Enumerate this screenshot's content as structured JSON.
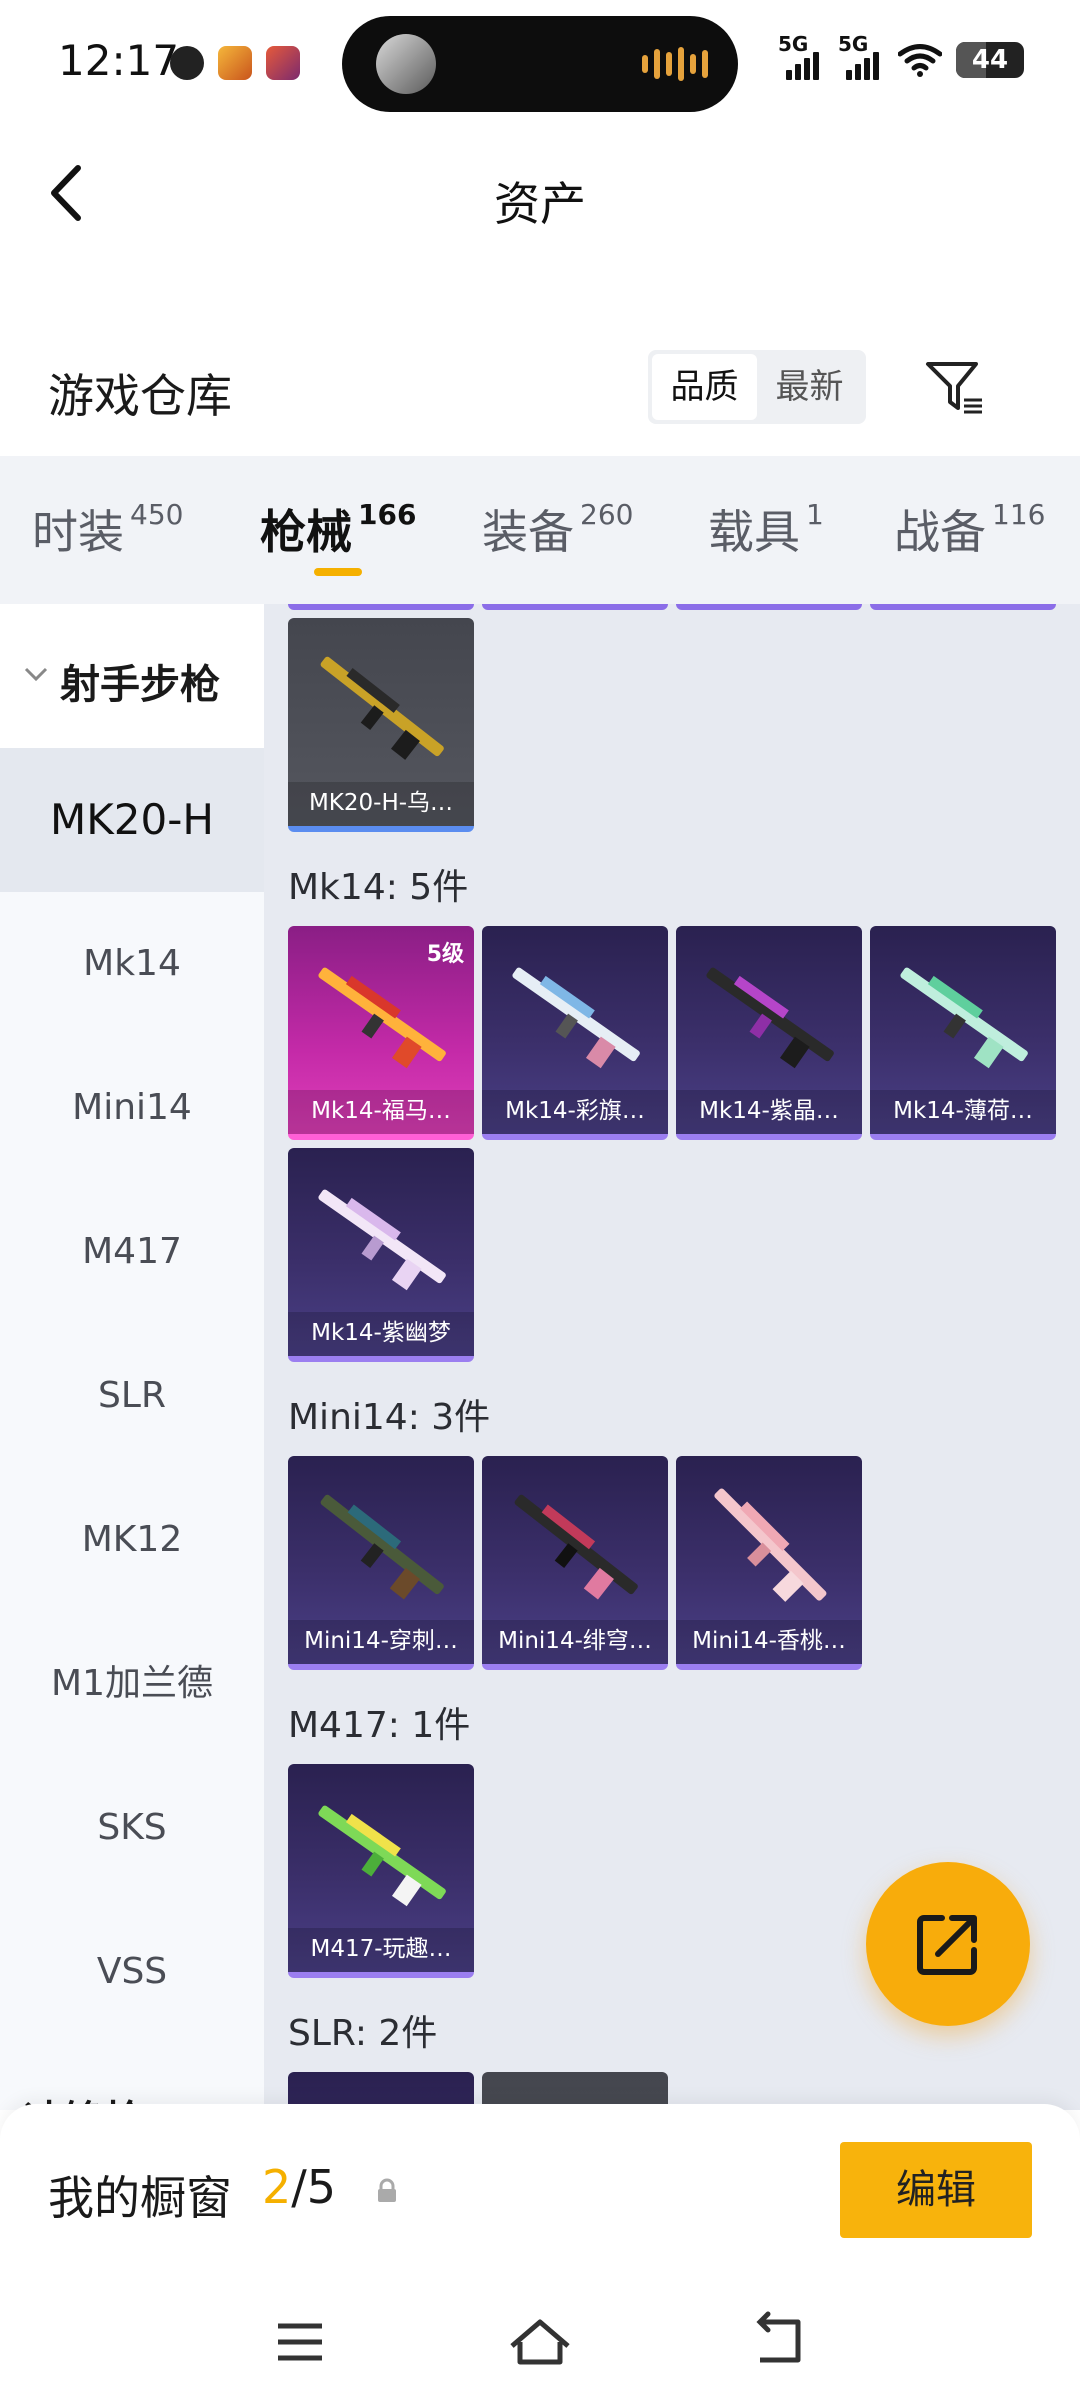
{
  "status_bar": {
    "time": "12:17",
    "signal1": "5G",
    "signal2": "5G",
    "battery": "44"
  },
  "header": {
    "title": "资产"
  },
  "warehouse": {
    "title": "游戏仓库",
    "sort_quality": "品质",
    "sort_latest": "最新"
  },
  "tabs": [
    {
      "label": "时装",
      "count": "450"
    },
    {
      "label": "枪械",
      "count": "166"
    },
    {
      "label": "装备",
      "count": "260"
    },
    {
      "label": "载具",
      "count": "1"
    },
    {
      "label": "战备",
      "count": "116"
    }
  ],
  "sidebar": {
    "group": "射手步枪",
    "items": [
      "MK20-H",
      "Mk14",
      "Mini14",
      "M417",
      "SLR",
      "MK12",
      "M1加兰德",
      "SKS",
      "VSS"
    ],
    "next_group": "冲锋枪"
  },
  "groups": [
    {
      "title": "",
      "cards": [
        {
          "name": "MK20-H-乌…"
        }
      ]
    },
    {
      "title": "Mk14: 5件",
      "cards": [
        {
          "name": "Mk14-福马…",
          "level": "5级"
        },
        {
          "name": "Mk14-彩旗…"
        },
        {
          "name": "Mk14-紫晶…"
        },
        {
          "name": "Mk14-薄荷…"
        },
        {
          "name": "Mk14-紫幽梦"
        }
      ]
    },
    {
      "title": "Mini14: 3件",
      "cards": [
        {
          "name": "Mini14-穿刺…"
        },
        {
          "name": "Mini14-绯穹…"
        },
        {
          "name": "Mini14-香桃…"
        }
      ]
    },
    {
      "title": "M417: 1件",
      "cards": [
        {
          "name": "M417-玩趣…"
        }
      ]
    },
    {
      "title": "SLR: 2件",
      "cards": []
    }
  ],
  "showcase": {
    "label": "我的橱窗",
    "current": "2",
    "total": "/5",
    "edit": "编辑"
  },
  "colors": {
    "accent": "#f8ac0b",
    "purple_rarity": "#9b7ef0",
    "pink_rarity": "#ff5fd6",
    "blue_rarity": "#5b8df0"
  }
}
